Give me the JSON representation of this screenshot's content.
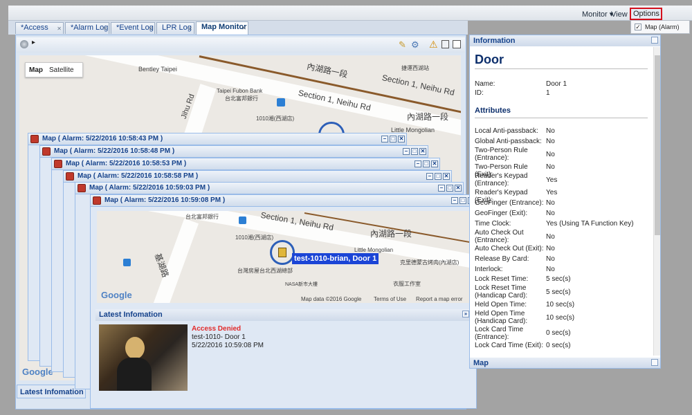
{
  "topbar": {
    "monitor": "Monitor",
    "view": "View",
    "options": "Options"
  },
  "options_menu": {
    "items": [
      {
        "label": "Map (Alarm)",
        "checked": true
      }
    ]
  },
  "tabs": [
    "*Access Log",
    "*Alarm Log",
    "*Event Log",
    "LPR Log",
    "Map Monitor"
  ],
  "map": {
    "type_buttons": [
      "Map",
      "Satellite"
    ],
    "labels": [
      "Bentley Taipei",
      "Taipei Fubon Bank",
      "台北富邦銀行",
      "Jihu Rd",
      "內湖路一段",
      "Section 1, Neihu Rd",
      "Section 1, Neihu Rd",
      "Little Mongolian",
      "1010湘(西湖店)",
      "捷運西湖站",
      "內湖路一段"
    ],
    "google": "Google",
    "footer": [
      "Map data ©2016 Google",
      "Terms of Use",
      "Report a map error"
    ]
  },
  "alarm_windows": [
    "Map ( Alarm: 5/22/2016 10:58:43 PM )",
    "Map ( Alarm: 5/22/2016 10:58:48 PM )",
    "Map ( Alarm: 5/22/2016 10:58:53 PM )",
    "Map ( Alarm: 5/22/2016 10:58:58 PM )",
    "Map ( Alarm: 5/22/2016 10:59:03 PM )",
    "Map ( Alarm: 5/22/2016 10:59:08 PM )"
  ],
  "front_map": {
    "labels": [
      "台北富邦銀行",
      "Section 1, Neihu Rd",
      "內湖路一段",
      "1010湘(西湖店)",
      "Little Mongolian",
      "基湖路",
      "台灣房屋台北西湖總部",
      "NASA新市大樓",
      "克里德蒙古烤肉(內湖店)",
      "衣服工作室"
    ],
    "marker_label": "test-1010-brian, Door 1",
    "google": "Google",
    "footer": [
      "Map data ©2016 Google",
      "Terms of Use",
      "Report a map error"
    ]
  },
  "latest": {
    "header": "Latest Infomation",
    "status": "Access Denied",
    "line1": "test-1010- Door 1",
    "line2": "5/22/2016 10:59:08 PM"
  },
  "back_latest": "Latest Infomation",
  "info": {
    "header": "Information",
    "title": "Door",
    "name_label": "Name:",
    "name_value": "Door 1",
    "id_label": "ID:",
    "id_value": "1",
    "attributes_heading": "Attributes",
    "attributes": [
      [
        "Local Anti-passback:",
        "No"
      ],
      [
        "Global Anti-passback:",
        "No"
      ],
      [
        "Two-Person Rule (Entrance):",
        "No"
      ],
      [
        "Two-Person Rule (Exit):",
        "No"
      ],
      [
        "Reader's Keypad (Entrance):",
        "Yes"
      ],
      [
        "Reader's Keypad (Exit):",
        "Yes"
      ],
      [
        "GeoFinger (Entrance):",
        "No"
      ],
      [
        "GeoFinger (Exit):",
        "No"
      ],
      [
        "Time Clock:",
        "Yes (Using TA Function Key)"
      ],
      [
        "Auto Check Out (Entrance):",
        "No"
      ],
      [
        "Auto Check Out (Exit):",
        "No"
      ],
      [
        "Release By Card:",
        "No"
      ],
      [
        "Interlock:",
        "No"
      ],
      [
        "Lock Reset Time:",
        "5 sec(s)"
      ],
      [
        "Lock Reset Time (Handicap Card):",
        "5 sec(s)"
      ],
      [
        "Held Open Time:",
        "10 sec(s)"
      ],
      [
        "Held Open Time (Handicap Card):",
        "10 sec(s)"
      ],
      [
        "Lock Card Time (Entrance):",
        "0 sec(s)"
      ],
      [
        "Lock Card Time (Exit):",
        "0 sec(s)"
      ]
    ],
    "bottom_header": "Map"
  }
}
